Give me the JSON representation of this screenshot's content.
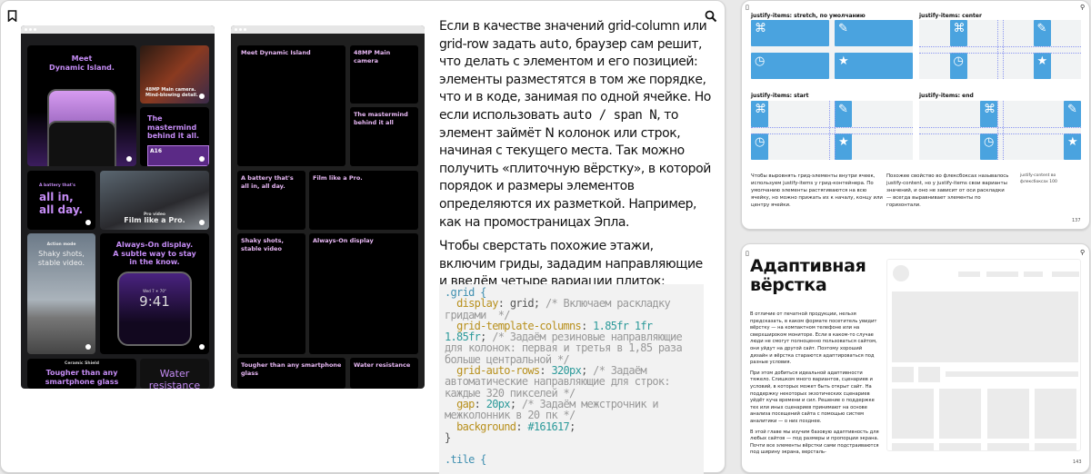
{
  "left_page": {
    "icons": {
      "bookmark": "bookmark-icon",
      "search": "search-icon"
    },
    "apple_mockup": {
      "tiles": [
        {
          "label": "Meet\nDynamic Island."
        },
        {
          "label": "48MP Main camera.\nMind-blowing detail."
        },
        {
          "label": "The\nmastermind\nbehind it all.",
          "chip": "A16"
        },
        {
          "kicker": "A battery that's",
          "label": "all in,\nall day."
        },
        {
          "kicker": "Pro video",
          "label": "Film like a Pro."
        },
        {
          "kicker": "Action mode",
          "label": "Shaky shots,\nstable video."
        },
        {
          "label": "Always-On display.\nA subtle way to stay\nin the know.",
          "time": "9:41",
          "date": "Wed 7  ☀ 70°"
        },
        {
          "kicker": "Ceramic Shield",
          "label": "Tougher than any\nsmartphone glass"
        },
        {
          "label": "Water\nresistance"
        }
      ]
    },
    "grid_mockup": {
      "tiles": [
        "Meet Dynamic Island",
        "48MP Main camera",
        "The mastermind behind it all",
        "A battery that's all in, all day.",
        "Film like a Pro.",
        "Shaky shots, stable video",
        "Always-On display",
        "Tougher than any smartphone glass",
        "Water resistance"
      ]
    },
    "paragraphs": [
      {
        "a": "Если в качестве значений grid-column или grid-row задать ",
        "code1": "auto",
        "b": ", браузер сам решит, что делать с элементом и его позицией: элементы разместятся в том же порядке, что и в коде, занимая по одной ячейке. Но если использовать ",
        "code2": "auto / span N",
        "c": ", то элемент займёт N колонок или строк, начиная с текущего места. Так можно получить «плиточную вёрстку», в которой порядок и размеры элементов определяются их разметкой. Например, как на промостраницах Эпла."
      },
      {
        "a": "Чтобы сверстать похожие этажи, включим гриды, зададим направляющие и введём четыре вариации плиток:"
      }
    ],
    "code": {
      "sel1": ".grid {",
      "p1": "display",
      "v1": "grid",
      "c1": "/* Включаем раскладку гридами  */",
      "p2": "grid-template-columns",
      "v2": "1.85fr 1fr 1.85fr",
      "c2": "/* Задаём резиновые направляющие для колонок: первая и третья в 1,85 раза больше центральной */",
      "p3": "grid-auto-rows",
      "v3": "320px",
      "c3": "/* Задаём автоматические направляющие для строк: каждые 320 пикселей */",
      "p4": "gap",
      "v4": "20px",
      "c4": "/* Задаём межстрочник и межколонник в 20 пк */",
      "p5": "background",
      "v5": "#161617",
      "close": "}",
      "sel2": ".tile {"
    }
  },
  "right_top_page": {
    "panels": [
      {
        "label": "justify-items: stretch, по умолчанию"
      },
      {
        "label": "justify-items: center"
      },
      {
        "label": "justify-items: start"
      },
      {
        "label": "justify-items: end"
      }
    ],
    "cell_icons": [
      "⌘",
      "✎",
      "◷",
      "★"
    ],
    "text_left": "Чтобы выровнять грид-элементы внутри ячеек, используем justify-items у грид-контейнера. По умолчанию элементы растягиваются на всю ячейку, но можно прижать их к началу, концу или центру ячейки.",
    "text_right": "Похожее свойство во флексбоксах называлось justify-content, но у justify-items свои варианты значений, и оно не зависит от оси раскладки — всегда выравнивает элементы по горизонтали.",
    "margin_note": "justify-content во флексбоксах",
    "margin_ref": "100",
    "page_number": "137"
  },
  "right_bottom_page": {
    "title": "Адаптивная вёрстка",
    "paragraphs": [
      "В отличие от печатной продукции, нельзя предсказать, в каком формате посетитель увидит вёрстку — на компактном телефоне или на сверхшироком мониторе. Если в каком-то случае люди не смогут полноценно пользоваться сайтом, они уйдут на другой сайт. Поэтому хороший дизайн и вёрстка стараются адаптироваться под разные условия.",
      "При этом добиться идеальной адаптивности тяжело. Слишком много вариантов, сценариев и условий, в которых может быть открыт сайт. На поддержку некоторых экзотических сценариев уйдёт куча времени и сил. Решение о поддержке тех или иных сценариев принимают на основе анализа посещений сайта с помощью систем аналитики — о них позднее.",
      "В этой главе мы изучим базовую адаптивность для любых сайтов — под размеры и пропорции экрана. Почти все элементы вёрстки сами подстраиваются под ширину экрана, версталь-"
    ],
    "page_number": "143"
  },
  "colors": {
    "accent_blue": "#4aa3df",
    "purple": "#c58cf5",
    "code_bg": "#f2f2f2"
  }
}
